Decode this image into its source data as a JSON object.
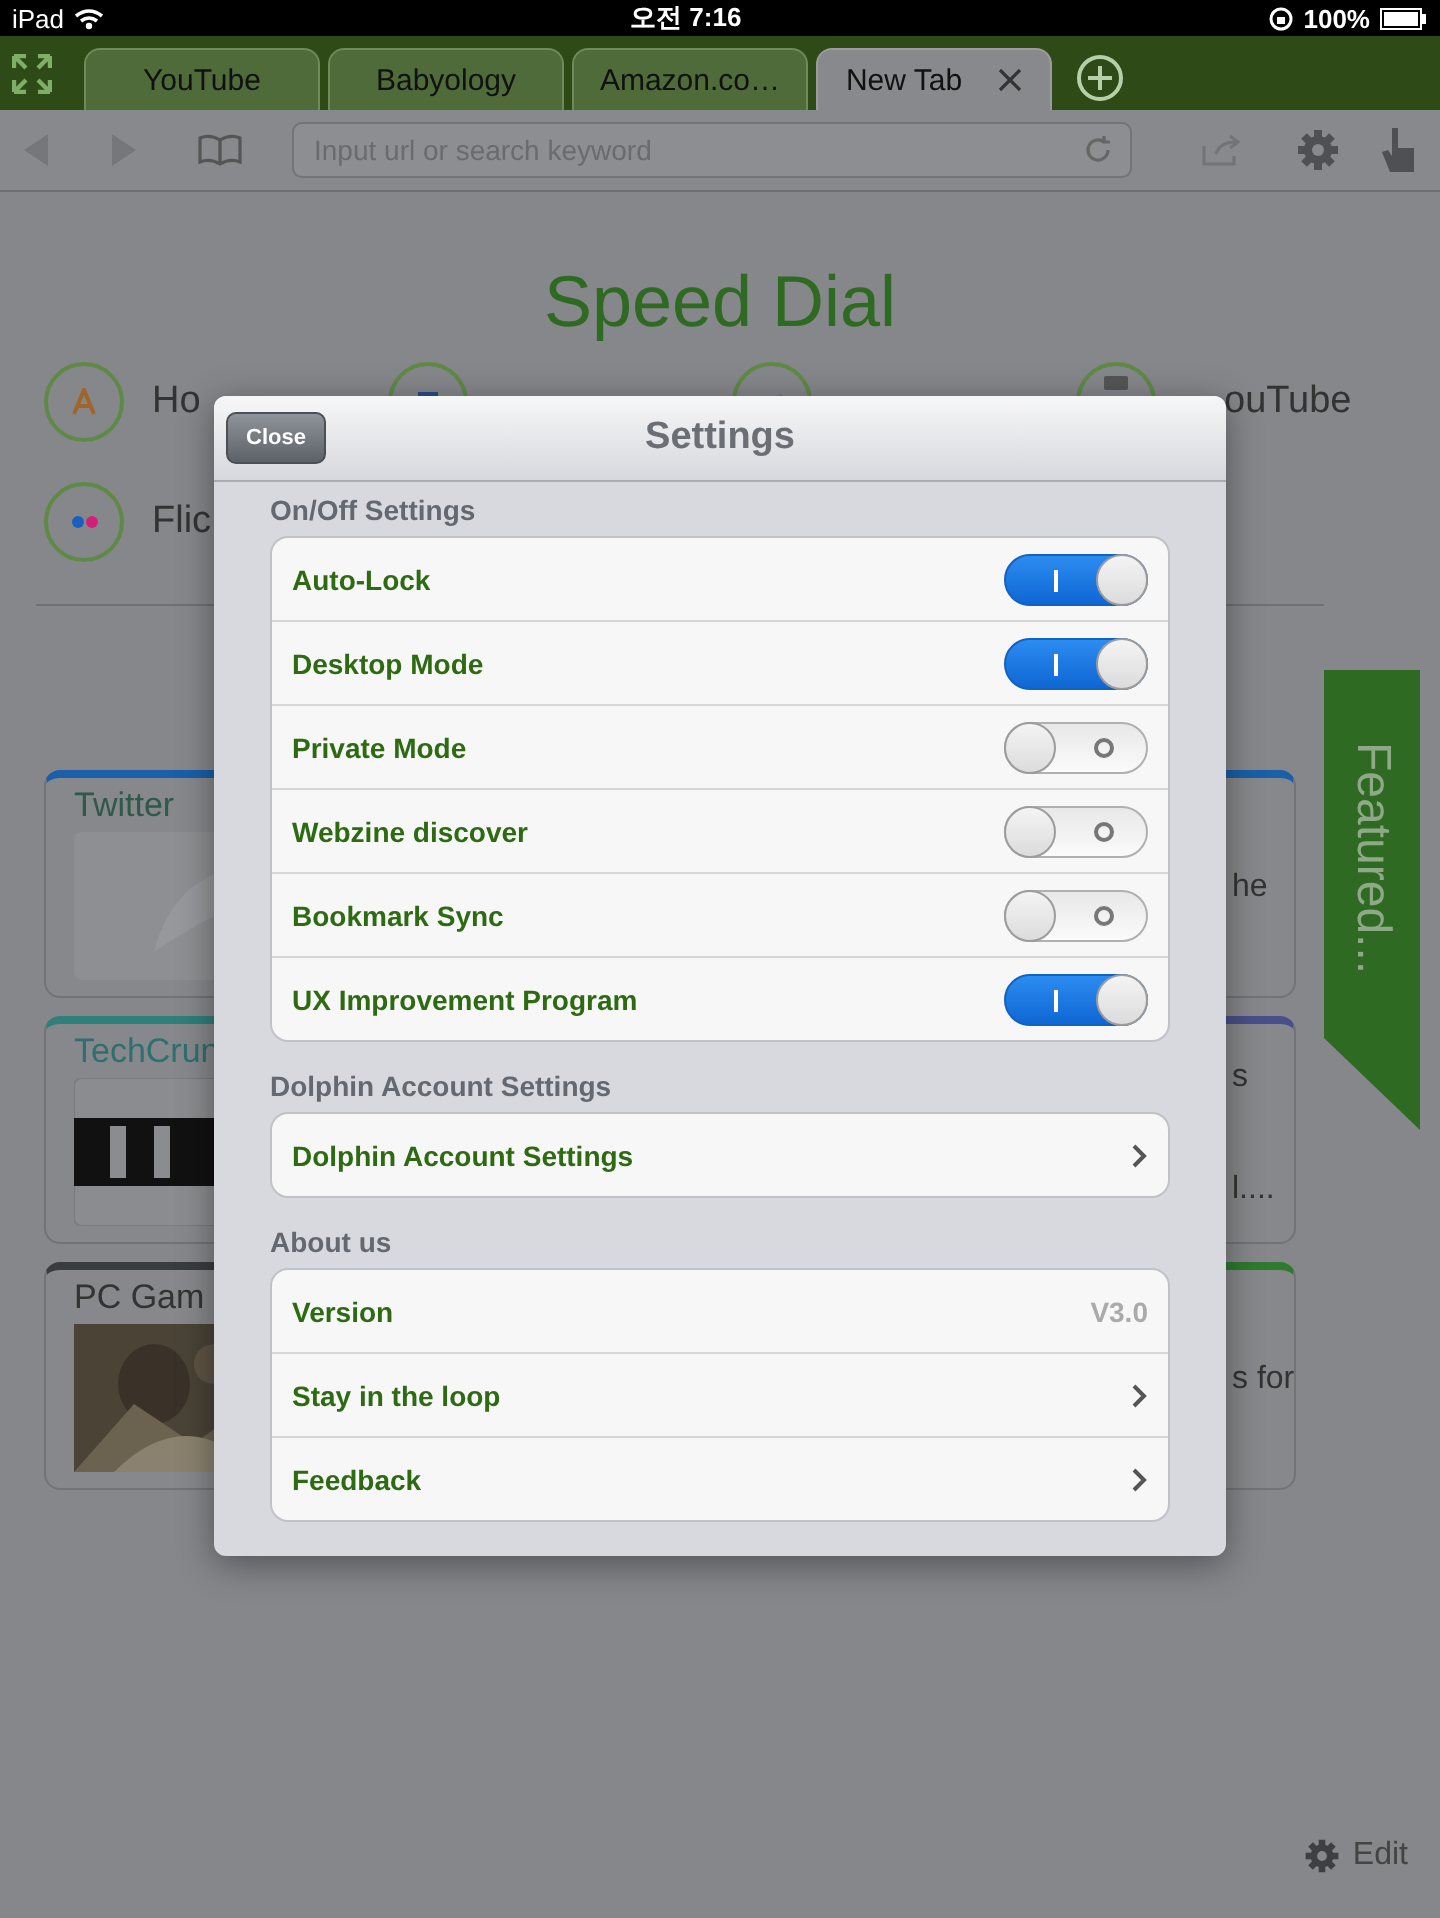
{
  "status_bar": {
    "device": "iPad",
    "time": "오전 7:16",
    "battery": "100%"
  },
  "tabs": [
    {
      "label": "YouTube",
      "selected": false
    },
    {
      "label": "Babyology",
      "selected": false
    },
    {
      "label": "Amazon.co…",
      "selected": false
    },
    {
      "label": "New Tab",
      "selected": true
    }
  ],
  "address_bar": {
    "placeholder": "Input url or search keyword"
  },
  "speed_dial": {
    "title": "Speed Dial",
    "items": [
      {
        "kind": "letter",
        "label": "Ho"
      },
      {
        "kind": "square"
      },
      {
        "kind": "bird"
      },
      {
        "kind": "tube",
        "label": "ouTube"
      },
      {
        "kind": "dots",
        "label": "Flic"
      }
    ]
  },
  "cards_left": [
    {
      "title": "Twitter",
      "color": "#1a5fa8",
      "kind": "dolphin"
    },
    {
      "title": "TechCrun",
      "color": "#2f7f7a",
      "kind": "logo"
    },
    {
      "title": "PC Gam",
      "color": "#3a3d40",
      "kind": "picture"
    }
  ],
  "cards_right": [
    {
      "snippet": "he",
      "color": "#1a5fa8"
    },
    {
      "snippet": "s",
      "color": "#4a4f8a",
      "extra": "l...."
    },
    {
      "snippet": "s for",
      "color": "#2f7a2f"
    }
  ],
  "featured": {
    "label": "Featured..."
  },
  "edit": {
    "label": "Edit"
  },
  "settings": {
    "title": "Settings",
    "close": "Close",
    "sections": [
      {
        "header": "On/Off Settings",
        "rows": [
          {
            "kind": "toggle",
            "label": "Auto-Lock",
            "on": true
          },
          {
            "kind": "toggle",
            "label": "Desktop Mode",
            "on": true
          },
          {
            "kind": "toggle",
            "label": "Private Mode",
            "on": false
          },
          {
            "kind": "toggle",
            "label": "Webzine discover",
            "on": false
          },
          {
            "kind": "toggle",
            "label": "Bookmark Sync",
            "on": false
          },
          {
            "kind": "toggle",
            "label": "UX Improvement Program",
            "on": true
          }
        ]
      },
      {
        "header": "Dolphin Account Settings",
        "rows": [
          {
            "kind": "link",
            "label": "Dolphin Account Settings"
          }
        ]
      },
      {
        "header": "About us",
        "rows": [
          {
            "kind": "value",
            "label": "Version",
            "value": "V3.0"
          },
          {
            "kind": "link",
            "label": "Stay in the loop"
          },
          {
            "kind": "link",
            "label": "Feedback"
          }
        ]
      }
    ]
  }
}
